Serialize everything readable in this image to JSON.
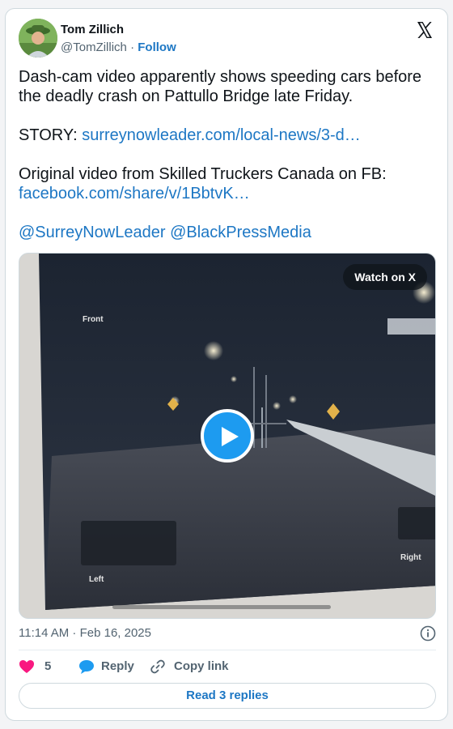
{
  "author": {
    "display_name": "Tom Zillich",
    "handle": "@TomZillich",
    "separator": "·",
    "follow_label": "Follow"
  },
  "tweet": {
    "line1": "Dash-cam video apparently shows speeding cars before the deadly crash on Pattullo Bridge late Friday.",
    "story_prefix": "STORY:",
    "story_link": "surreynowleader.com/local-news/3-d…",
    "video_credit": "Original video from Skilled Truckers Canada on FB:",
    "fb_link": "facebook.com/share/v/1BbtvK…",
    "mention1": "@SurreyNowLeader",
    "mention2": "@BlackPressMedia"
  },
  "media": {
    "watch_label": "Watch on X",
    "label_front": "Front",
    "label_left": "Left",
    "label_right": "Right",
    "progress": 0.0
  },
  "meta": {
    "timestamp": "11:14 AM · Feb 16, 2025"
  },
  "actions": {
    "likes": "5",
    "reply_label": "Reply",
    "copy_label": "Copy link",
    "read_replies_label": "Read 3 replies"
  },
  "colors": {
    "link": "#1d77c4",
    "like": "#f91880",
    "play": "#1d9bf0"
  },
  "icons": [
    "x-logo-icon",
    "play-icon",
    "info-icon",
    "heart-icon",
    "reply-bubble-icon",
    "link-icon"
  ]
}
